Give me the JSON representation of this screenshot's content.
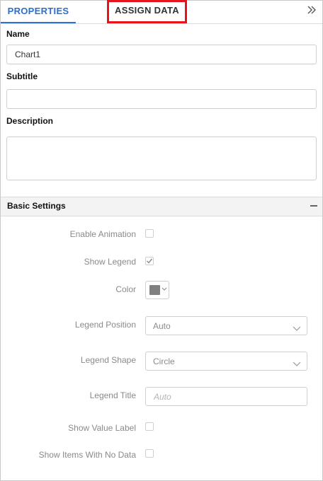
{
  "tabs": {
    "properties_label": "PROPERTIES",
    "assign_data_label": "ASSIGN DATA"
  },
  "fields": {
    "name_label": "Name",
    "name_value": "Chart1",
    "subtitle_label": "Subtitle",
    "subtitle_value": "",
    "description_label": "Description",
    "description_value": ""
  },
  "basic_settings": {
    "title": "Basic Settings",
    "enable_animation_label": "Enable Animation",
    "enable_animation_checked": false,
    "show_legend_label": "Show Legend",
    "show_legend_checked": true,
    "color_label": "Color",
    "color_value": "#808080",
    "legend_position_label": "Legend Position",
    "legend_position_value": "Auto",
    "legend_shape_label": "Legend Shape",
    "legend_shape_value": "Circle",
    "legend_title_label": "Legend Title",
    "legend_title_placeholder": "Auto",
    "show_value_label_label": "Show Value Label",
    "show_value_label_checked": false,
    "show_items_no_data_label": "Show Items With No Data",
    "show_items_no_data_checked": false
  },
  "icons": {
    "collapse_panel": "double-chevron-right-icon",
    "section_toggle": "minus-icon",
    "dropdown_arrow": "chevron-down-icon",
    "check_mark": "checkmark-icon"
  },
  "colors": {
    "accent": "#2b6fd1",
    "highlight": "#e8141b"
  }
}
